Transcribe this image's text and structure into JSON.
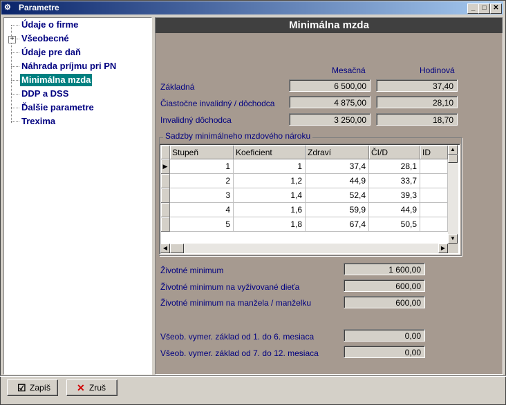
{
  "window": {
    "title": "Parametre"
  },
  "tree": {
    "items": [
      {
        "label": "Údaje o firme"
      },
      {
        "label": "Všeobecné"
      },
      {
        "label": "Údaje pre daň"
      },
      {
        "label": "Náhrada príjmu pri PN"
      },
      {
        "label": "Minimálna mzda"
      },
      {
        "label": "DDP a DSS"
      },
      {
        "label": "Ďalšie parametre"
      },
      {
        "label": "Trexima"
      }
    ],
    "selected": "Minimálna mzda"
  },
  "panel": {
    "title": "Minimálna mzda",
    "columns": {
      "monthly": "Mesačná",
      "hourly": "Hodinová"
    },
    "rates": [
      {
        "label": "Základná",
        "monthly": "6 500,00",
        "hourly": "37,40"
      },
      {
        "label": "Čiastočne invalidný / dôchodca",
        "monthly": "4 875,00",
        "hourly": "28,10"
      },
      {
        "label": "Invalidný dôchodca",
        "monthly": "3 250,00",
        "hourly": "18,70"
      }
    ],
    "group_title": "Sadzby minimálneho mzdového nároku",
    "table": {
      "headers": [
        "Stupeň",
        "Koeficient",
        "Zdraví",
        "ČI/D",
        "ID"
      ],
      "rows": [
        [
          "1",
          "1",
          "37,4",
          "28,1",
          ""
        ],
        [
          "2",
          "1,2",
          "44,9",
          "33,7",
          ""
        ],
        [
          "3",
          "1,4",
          "52,4",
          "39,3",
          ""
        ],
        [
          "4",
          "1,6",
          "59,9",
          "44,9",
          ""
        ],
        [
          "5",
          "1,8",
          "67,4",
          "50,5",
          ""
        ]
      ]
    },
    "minimums": [
      {
        "label": "Životné minimum",
        "value": "1 600,00"
      },
      {
        "label": "Životné minimum na vyživované dieťa",
        "value": "600,00"
      },
      {
        "label": "Životné minimum na manžela / manželku",
        "value": "600,00"
      }
    ],
    "bases": [
      {
        "label": "Všeob. vymer. základ od 1. do 6. mesiaca",
        "value": "0,00"
      },
      {
        "label": "Všeob. vymer. základ od 7. do 12. mesiaca",
        "value": "0,00"
      }
    ]
  },
  "buttons": {
    "save": "Zapíš",
    "cancel": "Zruš"
  },
  "colors": {
    "title_bar": "#0a246a",
    "panel_bg": "#a69a90",
    "tree_selected": "#008080",
    "label_text": "#000080"
  }
}
